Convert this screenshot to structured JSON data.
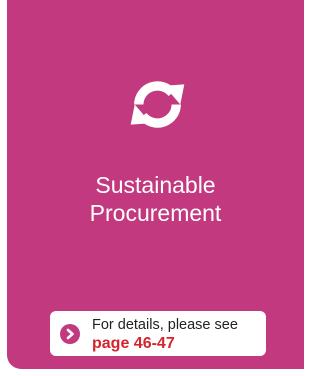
{
  "card": {
    "icon": "refresh-cycle-icon",
    "title_line1": "Sustainable",
    "title_line2": "Procurement",
    "background_color": "#c2397f"
  },
  "reference": {
    "arrow_icon": "chevron-right-icon",
    "text": "For details, please see",
    "page": "page 46-47",
    "page_color": "#d6242f"
  }
}
